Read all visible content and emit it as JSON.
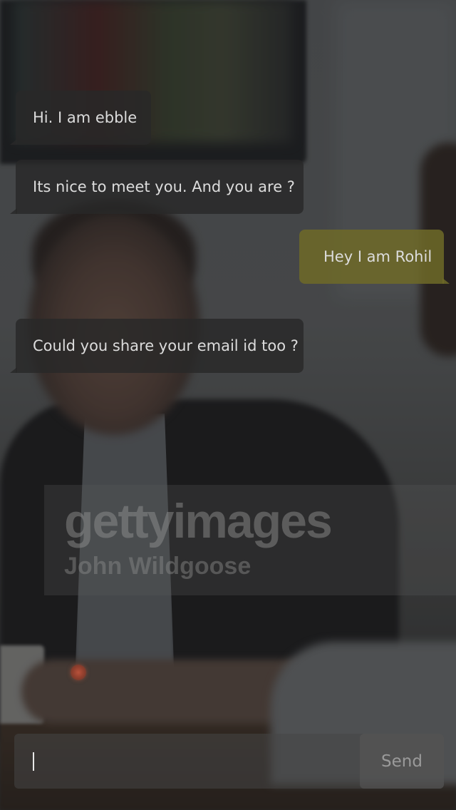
{
  "chat": {
    "messages": [
      {
        "sender": "bot",
        "text": "Hi. I am ebble"
      },
      {
        "sender": "bot",
        "text": "Its nice to meet you. And you are ?"
      },
      {
        "sender": "user",
        "text": "Hey I am Rohil"
      },
      {
        "sender": "bot",
        "text": "Could you share your email id too ?"
      }
    ]
  },
  "watermark": {
    "brand": "gettyimages",
    "credit": "John Wildgoose"
  },
  "composer": {
    "input_value": "",
    "send_label": "Send"
  },
  "colors": {
    "incoming_bubble": "#282828",
    "outgoing_bubble": "#6e6a28",
    "text": "#dcdcdc",
    "send_text": "#9a9a9a"
  }
}
